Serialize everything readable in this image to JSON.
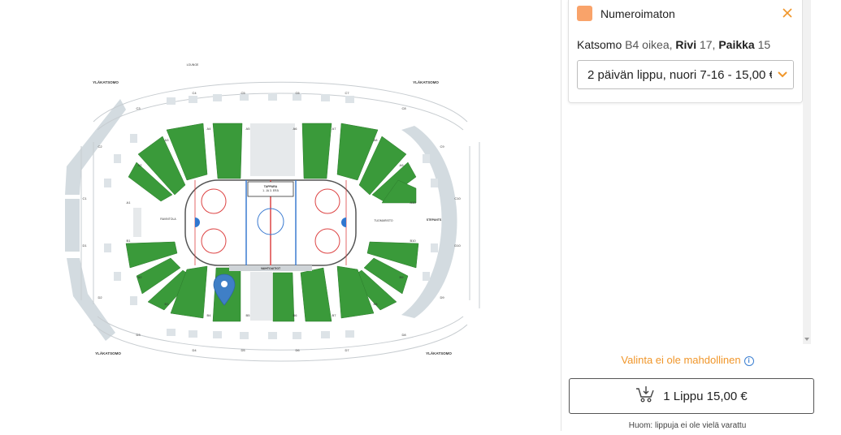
{
  "map": {
    "upper_label": "YLÄKATSOMO",
    "lounge_label": "LOUNGE",
    "stand_labels": [
      "C1",
      "C2",
      "C3",
      "C4",
      "C5",
      "C6",
      "C7",
      "C8",
      "C9",
      "C10",
      "C11",
      "D1",
      "D2",
      "D3",
      "D4",
      "D5",
      "D6",
      "D7",
      "D8",
      "D9",
      "D10",
      "A1",
      "A2",
      "A3",
      "A4",
      "A5",
      "A6",
      "A7",
      "A8",
      "A9",
      "A10",
      "B1",
      "B2",
      "B3",
      "B4",
      "B5",
      "B6",
      "B7",
      "B8",
      "B9",
      "B10"
    ],
    "scoreboard": "TAPPARA\n1. JA 3. ERÄ",
    "vaihtoaitio": "VAIHTOAITIOT",
    "tuomaristo": "TUOMARISTO",
    "stepants": "STEPANTS",
    "kuskus_small": "MEDIAALUE",
    "ravintola": "RAVINTOLA",
    "colors": {
      "seat_green": "#3a9a3a",
      "grey_stand": "#d3dbe0",
      "pin": "#3f7fc6"
    }
  },
  "panel": {
    "category": {
      "label": "Numeroimaton",
      "color": "#f9a36a"
    },
    "close_icon": "close-icon",
    "seat": {
      "section_key": "Katsomo",
      "section_val": "B4 oikea,",
      "row_key": "Rivi",
      "row_val": "17,",
      "seat_key": "Paikka",
      "seat_val": "15"
    },
    "ticket_select": {
      "value": "2 päivän lippu, nuori 7-16 - 15,00 €"
    },
    "notice": "Valinta ei ole mahdollinen",
    "buy_button": {
      "label": "1 Lippu 15,00 €"
    },
    "footer_note": "Huom: lippuja ei ole vielä varattu",
    "accent": "#f0962a"
  }
}
